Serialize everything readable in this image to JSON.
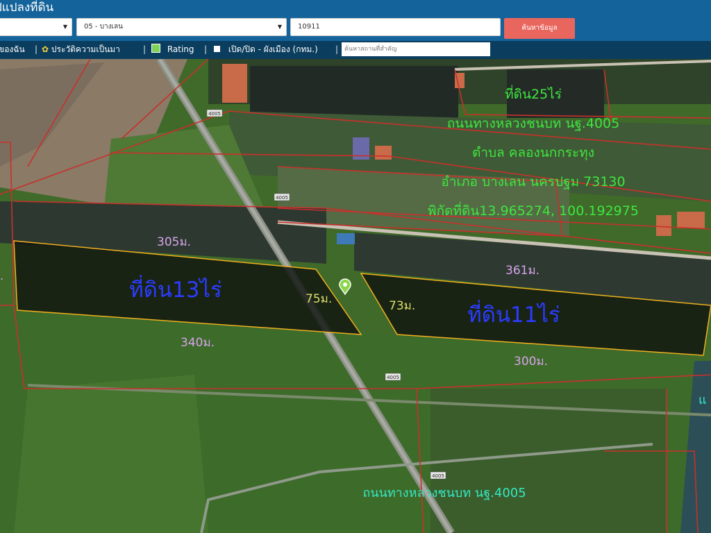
{
  "header": {
    "title": "ปแปลงที่ดิน",
    "amphoe_select": "05 - บางเลน",
    "parcel_number": "10911",
    "search_button": "ค้นหาข้อมูล"
  },
  "toolbar": {
    "item_1": "ของฉัน",
    "separator": "|",
    "history_label": "ประวัติความเป็นมา",
    "rating_label": "Rating",
    "layer_label": "เปิด/ปิด - ผังเมือง (กทม.)",
    "place_placeholder": "ค้นหาสถานที่สำคัญ"
  },
  "map": {
    "info_lines": [
      "ที่ดิน25ไร่",
      "ถนนทางหลวงชนบท นฐ.4005",
      "ตำบล คลองนกกระทุง",
      "อำเภอ บางเลน นครปฐม 73130",
      "พิกัดที่ดิน13.965274, 100.192975"
    ],
    "left_plot_label": "ที่ดิน13ไร่",
    "right_plot_label": "ที่ดิน11ไร่",
    "dim_top_left": "305ม.",
    "dim_bottom_left": "340ม.",
    "dim_road_left": "75ม.",
    "dim_road_right": "73ม.",
    "dim_top_right": "361ม.",
    "dim_bottom_right": "300ม.",
    "road_label": "ถนนทางหลวงชนบท นฐ.4005",
    "road_shield_1": "4005",
    "road_shield_2": "4005",
    "road_shield_3": "4005",
    "road_shield_4": "4005",
    "edge_left_fragment": "ี.",
    "edge_right_fragment": "แ",
    "colors": {
      "info_text": "#3fe63f",
      "plot_label": "#2b3cff",
      "dimension_text": "#d7a3ea",
      "road_dimension": "#dede6a",
      "road_label": "#35e9c4",
      "parcel_outline": "#c9302c",
      "plot_outline": "#f0b020"
    }
  }
}
